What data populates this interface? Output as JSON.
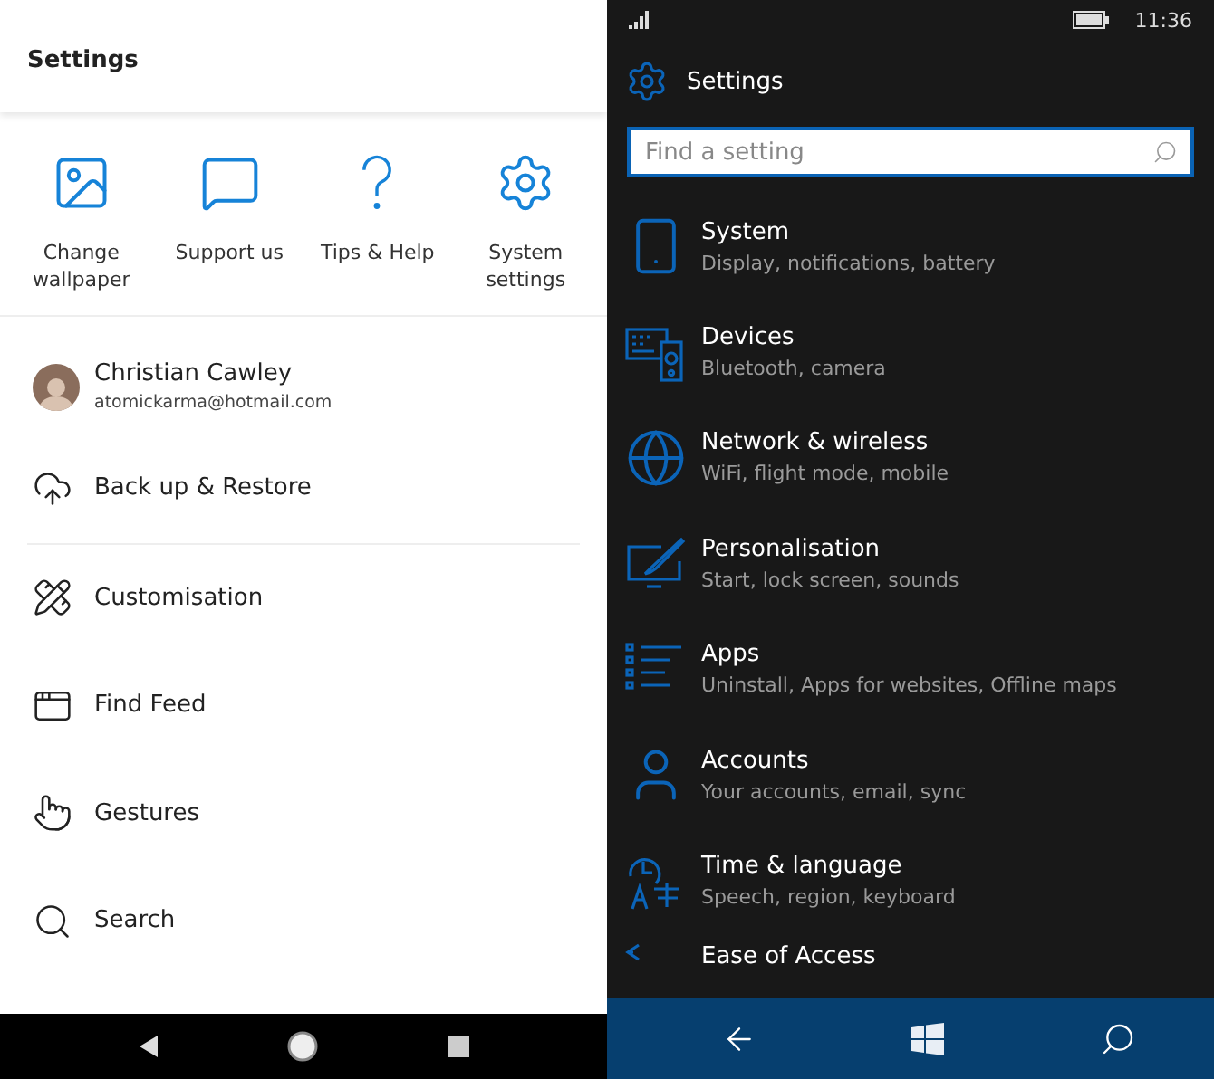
{
  "launcher": {
    "title": "Settings",
    "quick_actions": [
      {
        "label": "Change wallpaper"
      },
      {
        "label": "Support us"
      },
      {
        "label": "Tips & Help"
      },
      {
        "label": "System settings"
      }
    ],
    "account": {
      "name": "Christian Cawley",
      "email": "atomickarma@hotmail.com"
    },
    "menu": [
      {
        "label": "Back up & Restore"
      },
      {
        "label": "Customisation"
      },
      {
        "label": "Find Feed"
      },
      {
        "label": "Gestures"
      },
      {
        "label": "Search"
      }
    ]
  },
  "phone": {
    "status_bar": {
      "time": "11:36"
    },
    "title": "Settings",
    "search": {
      "placeholder": "Find a setting"
    },
    "categories": [
      {
        "title": "System",
        "subtitle": "Display, notifications, battery"
      },
      {
        "title": "Devices",
        "subtitle": "Bluetooth, camera"
      },
      {
        "title": "Network & wireless",
        "subtitle": "WiFi, flight mode, mobile"
      },
      {
        "title": "Personalisation",
        "subtitle": "Start, lock screen, sounds"
      },
      {
        "title": "Apps",
        "subtitle": "Uninstall, Apps for websites, Offline maps"
      },
      {
        "title": "Accounts",
        "subtitle": "Your accounts, email, sync"
      },
      {
        "title": "Time & language",
        "subtitle": "Speech, region, keyboard"
      },
      {
        "title": "Ease of Access"
      }
    ]
  }
}
